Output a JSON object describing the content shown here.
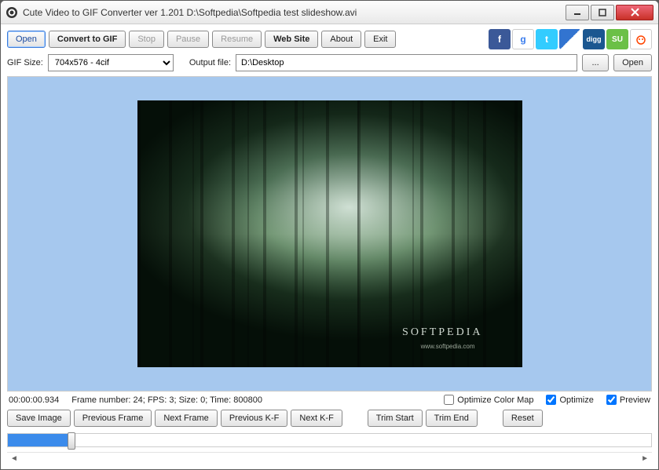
{
  "window": {
    "title": "Cute Video to GIF Converter ver 1.201  D:\\Softpedia\\Softpedia test slideshow.avi"
  },
  "toolbar": {
    "open": "Open",
    "convert": "Convert to GIF",
    "stop": "Stop",
    "pause": "Pause",
    "resume": "Resume",
    "website": "Web Site",
    "about": "About",
    "exit": "Exit"
  },
  "social": {
    "facebook": "f",
    "google": "g",
    "twitter": "t",
    "delicious": "d",
    "digg": "digg",
    "stumble": "SU",
    "reddit": "r"
  },
  "row2": {
    "gif_size_label": "GIF Size:",
    "gif_size_value": "704x576 - 4cif",
    "output_label": "Output file:",
    "output_value": "D:\\Desktop",
    "browse": "...",
    "open2": "Open"
  },
  "preview": {
    "watermark": "SOFTPEDIA",
    "watermark_sub": "www.softpedia.com"
  },
  "status": {
    "timecode": "00:00:00.934",
    "info": "Frame number: 24; FPS: 3; Size: 0; Time: 800800",
    "optimize_color_map": "Optimize Color Map",
    "optimize": "Optimize",
    "preview": "Preview",
    "optimize_color_map_checked": false,
    "optimize_checked": true,
    "preview_checked": true
  },
  "buttons": {
    "save_image": "Save Image",
    "prev_frame": "Previous Frame",
    "next_frame": "Next Frame",
    "prev_kf": "Previous K-F",
    "next_kf": "Next K-F",
    "trim_start": "Trim Start",
    "trim_end": "Trim End",
    "reset": "Reset"
  }
}
